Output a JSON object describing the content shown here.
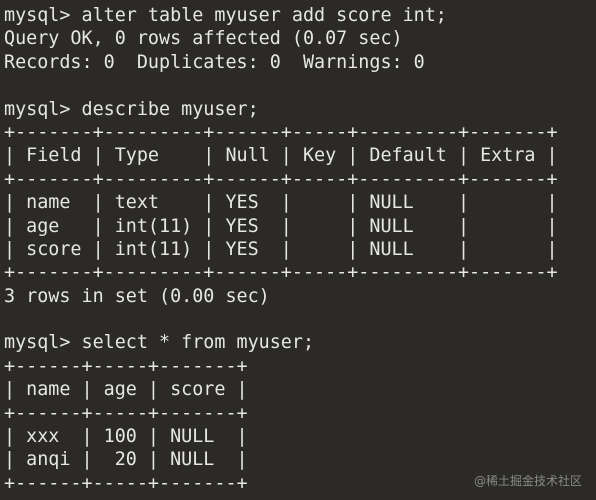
{
  "terminal": {
    "lines": [
      "mysql> alter table myuser add score int;",
      "Query OK, 0 rows affected (0.07 sec)",
      "Records: 0  Duplicates: 0  Warnings: 0",
      "",
      "mysql> describe myuser;",
      "+-------+---------+------+-----+---------+-------+",
      "| Field | Type    | Null | Key | Default | Extra |",
      "+-------+---------+------+-----+---------+-------+",
      "| name  | text    | YES  |     | NULL    |       |",
      "| age   | int(11) | YES  |     | NULL    |       |",
      "| score | int(11) | YES  |     | NULL    |       |",
      "+-------+---------+------+-----+---------+-------+",
      "3 rows in set (0.00 sec)",
      "",
      "mysql> select * from myuser;",
      "+------+-----+-------+",
      "| name | age | score |",
      "+------+-----+-------+",
      "| xxx  | 100 | NULL  |",
      "| anqi |  20 | NULL  |",
      "+------+-----+-------+"
    ]
  },
  "watermark": "@稀土掘金技术社区",
  "colors": {
    "background": "#2b2a26",
    "text": "#e6e6e2"
  }
}
